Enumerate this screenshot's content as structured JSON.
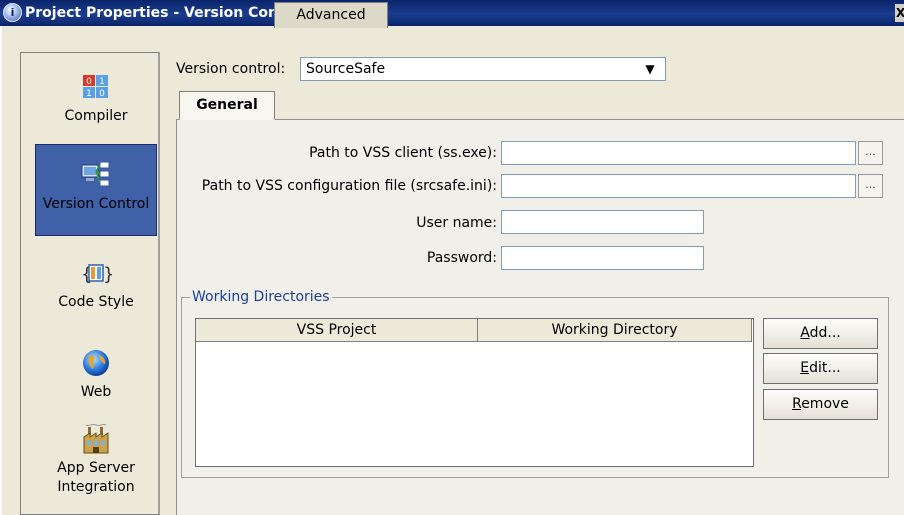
{
  "window": {
    "title": "Project Properties - Version Control",
    "close_glyph": "X"
  },
  "sidebar": {
    "items": [
      {
        "label": "Compiler",
        "icon": "compiler-icon"
      },
      {
        "label": "Version Control",
        "icon": "version-control-icon",
        "selected": true
      },
      {
        "label": "Code Style",
        "icon": "code-style-icon"
      },
      {
        "label": "Web",
        "icon": "web-globe-icon"
      },
      {
        "label": "App Server",
        "label2": "Integration",
        "icon": "app-server-icon"
      }
    ]
  },
  "version_control": {
    "label": "Version control:",
    "selected": "SourceSafe"
  },
  "tabs": [
    {
      "label": "General",
      "active": true
    },
    {
      "label": "Advanced",
      "active": false
    }
  ],
  "general": {
    "vss_client_label": "Path to VSS client (ss.exe):",
    "vss_client_value": "",
    "vss_config_label": "Path to VSS configuration file (srcsafe.ini):",
    "vss_config_value": "",
    "browse_label": "...",
    "username_label": "User name:",
    "username_value": "",
    "password_label": "Password:",
    "password_value": ""
  },
  "working_directories": {
    "title": "Working Directories",
    "columns": [
      "VSS Project",
      "Working Directory"
    ],
    "rows": [],
    "buttons": {
      "add_mnemonic": "A",
      "add_rest": "dd...",
      "edit_mnemonic": "E",
      "edit_rest": "dit...",
      "remove_mnemonic": "R",
      "remove_rest": "emove"
    }
  },
  "colors": {
    "titlebar": "#0a246a",
    "selected_item": "#4060a8",
    "group_title": "#1c3f9c"
  }
}
